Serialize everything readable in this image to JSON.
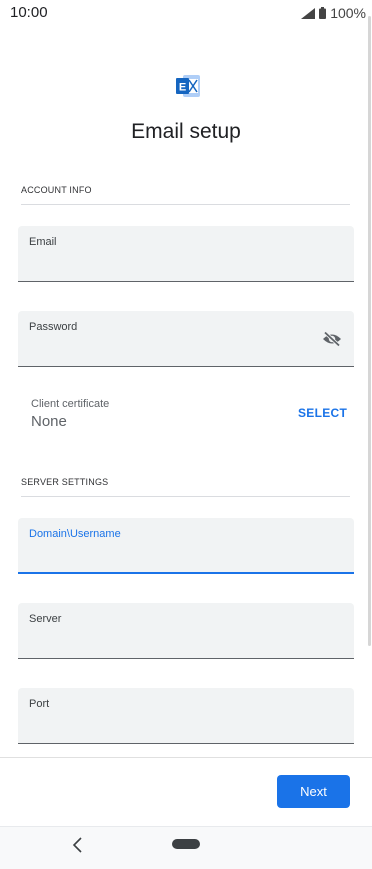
{
  "status_bar": {
    "time": "10:00",
    "battery": "100%"
  },
  "header": {
    "logo": "exchange-logo",
    "title": "Email setup"
  },
  "account_info": {
    "section_title": "ACCOUNT INFO",
    "email_label": "Email",
    "password_label": "Password",
    "visibility_icon": "eye-off-icon",
    "client_certificate_label": "Client certificate",
    "client_certificate_value": "None",
    "select_label": "SELECT"
  },
  "server_settings": {
    "section_title": "SERVER SETTINGS",
    "domain_label": "Domain\\Username",
    "server_label": "Server",
    "port_label": "Port"
  },
  "footer": {
    "next_label": "Next"
  },
  "colors": {
    "accent": "#1a73e8",
    "field_bg": "#f1f3f4"
  }
}
